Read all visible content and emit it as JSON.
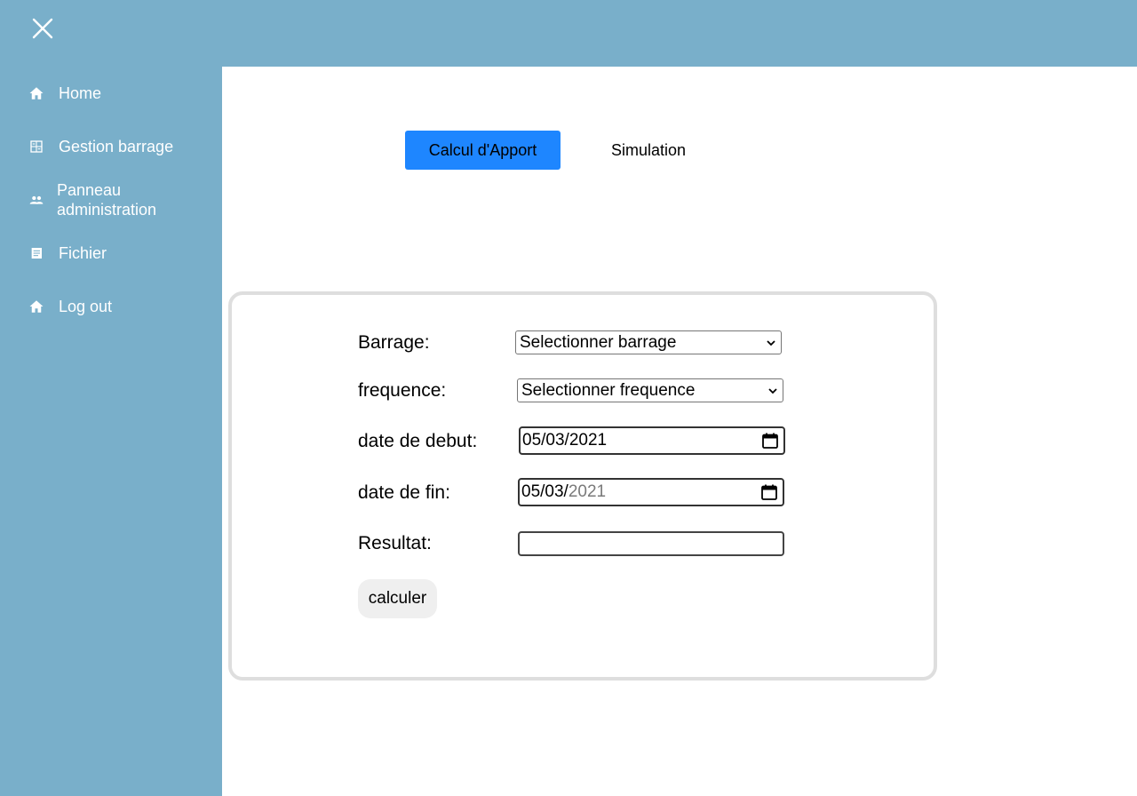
{
  "header": {
    "close_icon": "close-icon"
  },
  "sidebar": {
    "items": [
      {
        "label": "Home",
        "icon": "home-icon"
      },
      {
        "label": "Gestion barrage",
        "icon": "calculator-icon"
      },
      {
        "label": "Panneau administration",
        "icon": "people-icon"
      },
      {
        "label": "Fichier",
        "icon": "document-icon"
      },
      {
        "label": "Log out",
        "icon": "home-icon"
      }
    ]
  },
  "tabs": {
    "active": "Calcul d'Apport",
    "inactive": "Simulation",
    "active_color": "#1e86ff"
  },
  "form": {
    "barrage_label": "Barrage:",
    "barrage_value": "Selectionner barrage",
    "frequence_label": "frequence:",
    "frequence_value": "Selectionner frequence",
    "date_debut_label": "date de debut:",
    "date_debut_value": "05/03/2021",
    "date_fin_label": "date de fin:",
    "date_fin_value_day_month": "05/03/",
    "date_fin_value_year": "2021",
    "resultat_label": "Resultat:",
    "resultat_value": "",
    "calculer_label": "calculer"
  },
  "colors": {
    "sidebar_bg": "#79afca",
    "card_border": "#dedede"
  }
}
